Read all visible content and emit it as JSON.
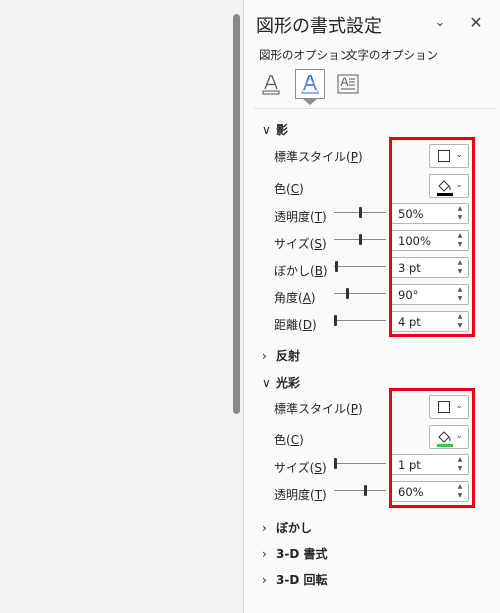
{
  "panel": {
    "title": "図形の書式設定",
    "dropdown_icon": "chevron-down-icon",
    "close_icon": "close-icon",
    "close_glyph": "✕",
    "dropdown_glyph": "⌄"
  },
  "option_tabs": {
    "shape": "図形のオプション",
    "text": "文字のオプション"
  },
  "icon_tabs": [
    "text-fill-outline-icon",
    "text-effects-icon",
    "text-layout-icon"
  ],
  "sections": {
    "shadow": {
      "label": "影",
      "expanded": true,
      "rows": {
        "preset": {
          "label": "標準スタイル(P)",
          "label_pre": "標準スタイル(",
          "label_key": "P",
          "label_post": ")"
        },
        "color": {
          "label": "色(C)",
          "label_pre": "色(",
          "label_key": "C",
          "label_post": ")",
          "swatch": "#000000"
        },
        "transparency": {
          "label_pre": "透明度(",
          "label_key": "T",
          "label_post": ")",
          "value": "50%",
          "level": 0.5
        },
        "size": {
          "label_pre": "サイズ(",
          "label_key": "S",
          "label_post": ")",
          "value": "100%",
          "level": 0.5
        },
        "blur": {
          "label_pre": "ぼかし(",
          "label_key": "B",
          "label_post": ")",
          "value": "3 pt",
          "level": 0.03
        },
        "angle": {
          "label_pre": "角度(",
          "label_key": "A",
          "label_post": ")",
          "value": "90°",
          "level": 0.25
        },
        "distance": {
          "label_pre": "距離(",
          "label_key": "D",
          "label_post": ")",
          "value": "4 pt",
          "level": 0.02
        }
      }
    },
    "reflection": {
      "label": "反射",
      "expanded": false
    },
    "glow": {
      "label": "光彩",
      "expanded": true,
      "rows": {
        "preset": {
          "label_pre": "標準スタイル(",
          "label_key": "P",
          "label_post": ")"
        },
        "color": {
          "label_pre": "色(",
          "label_key": "C",
          "label_post": ")",
          "swatch": "#3cc53c"
        },
        "size": {
          "label_pre": "サイズ(",
          "label_key": "S",
          "label_post": ")",
          "value": "1 pt",
          "level": 0.01
        },
        "transparency": {
          "label_pre": "透明度(",
          "label_key": "T",
          "label_post": ")",
          "value": "60%",
          "level": 0.6
        }
      }
    },
    "soft_edges": {
      "label": "ぼかし",
      "expanded": false
    },
    "format_3d": {
      "label": "3-D 書式",
      "expanded": false
    },
    "rotation_3d": {
      "label": "3-D 回転",
      "expanded": false
    }
  },
  "chevrons": {
    "expanded": "∨",
    "collapsed": "›"
  },
  "spin_arrows": {
    "up": "▲",
    "down": "▼"
  },
  "colors": {
    "highlight": "#e60012",
    "panel_bg": "#fafafa",
    "accent": "#2b62d9"
  }
}
